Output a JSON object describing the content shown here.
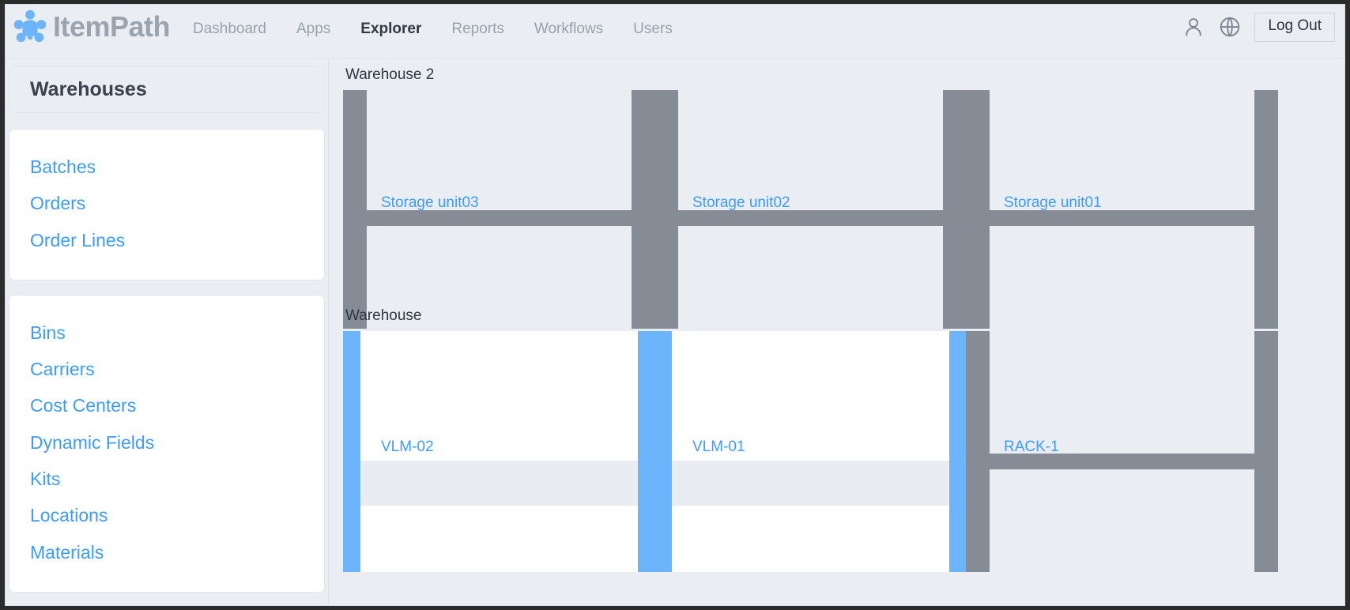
{
  "header": {
    "logo_text": "ItemPath",
    "logo_icon": "itempath-molecule-logo",
    "nav": [
      {
        "label": "Dashboard",
        "active": false
      },
      {
        "label": "Apps",
        "active": false
      },
      {
        "label": "Explorer",
        "active": true
      },
      {
        "label": "Reports",
        "active": false
      },
      {
        "label": "Workflows",
        "active": false
      },
      {
        "label": "Users",
        "active": false
      }
    ],
    "user_icon": "user-icon",
    "language_icon": "globe-icon",
    "logout_label": "Log Out"
  },
  "sidebar": {
    "title": "Warehouses",
    "group_a": [
      {
        "label": "Batches"
      },
      {
        "label": "Orders"
      },
      {
        "label": "Order Lines"
      }
    ],
    "group_b": [
      {
        "label": "Bins"
      },
      {
        "label": "Carriers"
      },
      {
        "label": "Cost Centers"
      },
      {
        "label": "Dynamic Fields"
      },
      {
        "label": "Kits"
      },
      {
        "label": "Locations"
      },
      {
        "label": "Materials"
      }
    ]
  },
  "map": {
    "warehouses": [
      {
        "name": "Warehouse 2"
      },
      {
        "name": "Warehouse"
      }
    ],
    "units": [
      {
        "label": "Storage unit03",
        "kind": "rack"
      },
      {
        "label": "Storage unit02",
        "kind": "rack"
      },
      {
        "label": "Storage unit01",
        "kind": "rack"
      },
      {
        "label": "VLM-02",
        "kind": "vlm"
      },
      {
        "label": "VLM-01",
        "kind": "vlm"
      },
      {
        "label": "RACK-1",
        "kind": "rack"
      }
    ]
  },
  "colors": {
    "accent_blue": "#3d9cfb",
    "vlm_blue": "#6cb4fc",
    "rack_gray": "#858c95",
    "page_bg": "#eaeef2",
    "logo_gray": "#9ba4ae"
  }
}
